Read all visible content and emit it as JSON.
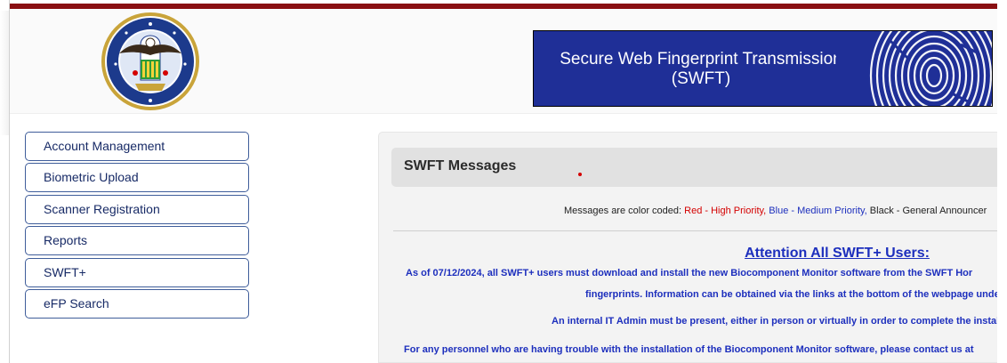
{
  "banner": {
    "line1": "Secure Web Fingerprint Transmission",
    "line2": "(SWFT)",
    "color": "#1f2f97"
  },
  "seal": {
    "icon": "agency-seal-icon"
  },
  "sidebar": {
    "items": [
      {
        "label": "Account Management"
      },
      {
        "label": "Biometric Upload"
      },
      {
        "label": "Scanner Registration"
      },
      {
        "label": "Reports"
      },
      {
        "label": "SWFT+"
      },
      {
        "label": "eFP Search"
      }
    ]
  },
  "messages": {
    "title": "SWFT Messages",
    "legend": {
      "prefix": "Messages are color coded: ",
      "red": "Red - High Priority,",
      "blue": " Blue - Medium Priority,",
      "black": " Black - General Announcer"
    },
    "attention_title": "Attention All SWFT+ Users:",
    "lines": [
      "As of 07/12/2024, all SWFT+ users must download and install the new Biocomponent Monitor software from the SWFT Hor",
      "fingerprints. Information can be obtained via the links at the bottom of the webpage under the DOWN",
      "An internal IT Admin must be present, either in person or virtually in order to complete the installa",
      "For any personnel who are having trouble with the installation of the Biocomponent Monitor software, please contact us at"
    ]
  },
  "colors": {
    "accent_red": "#8a0f12",
    "high_priority": "#d40000",
    "medium_priority": "#1d2fbd"
  }
}
